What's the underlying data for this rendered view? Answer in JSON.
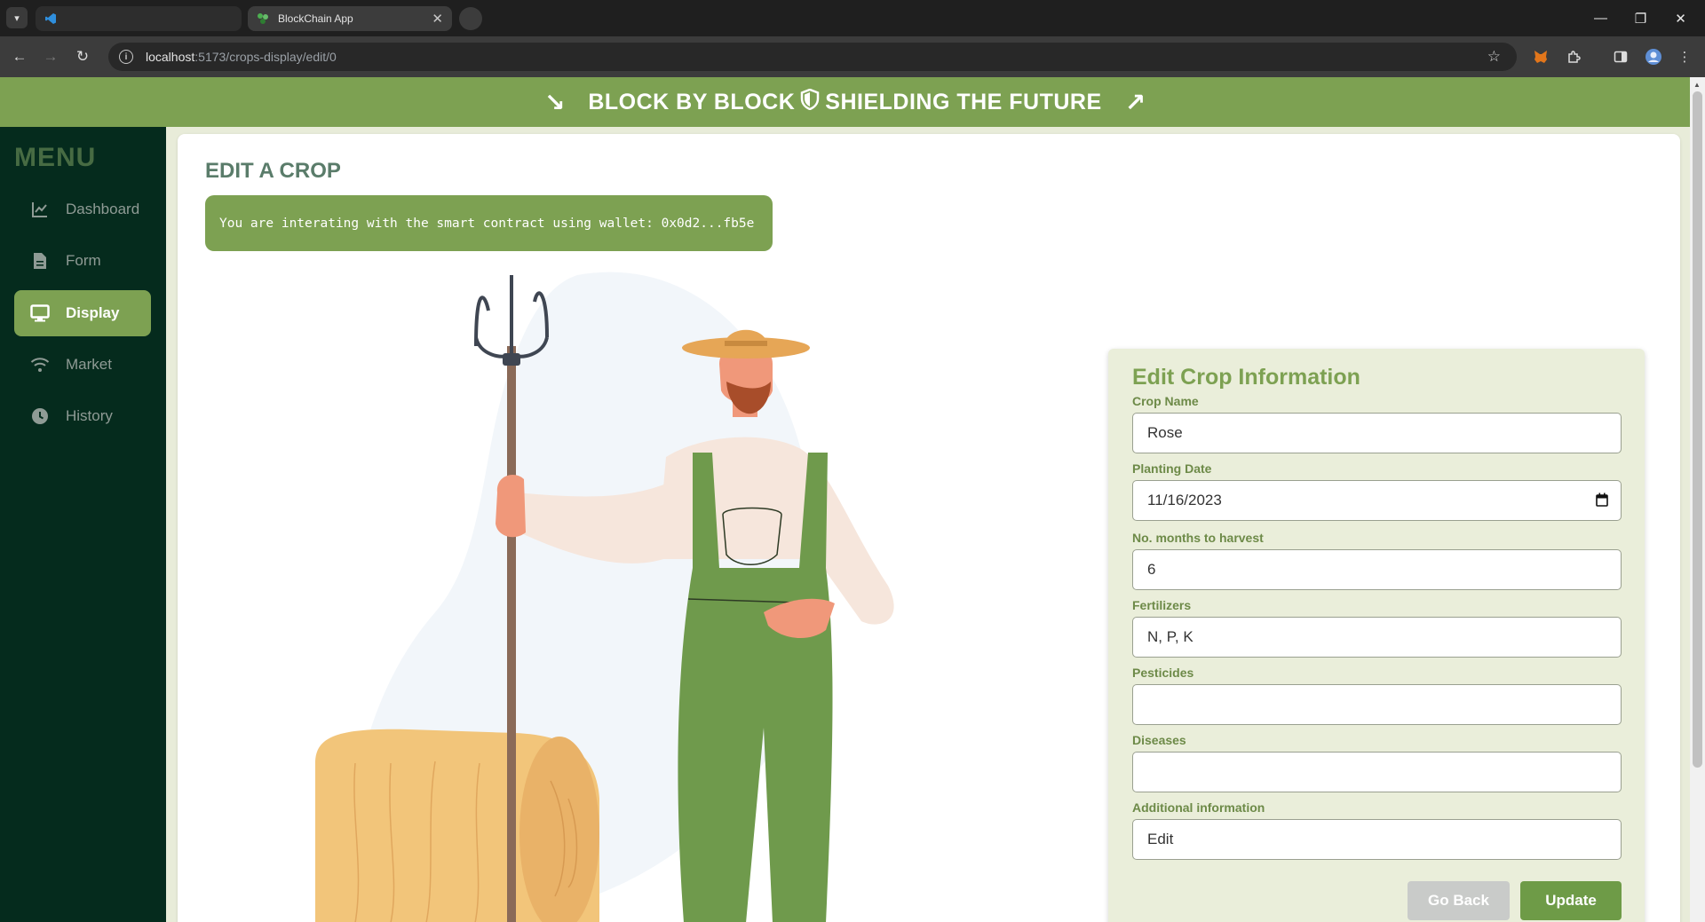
{
  "browser": {
    "tabs": [
      {
        "title": "",
        "active": false
      },
      {
        "title": "BlockChain App",
        "active": true
      }
    ],
    "url_host": "localhost",
    "url_path": ":5173/crops-display/edit/0"
  },
  "banner": {
    "text_left": "BLOCK BY BLOCK",
    "text_right": "SHIELDING THE FUTURE",
    "trend_left": "↘",
    "trend_right": "↗"
  },
  "sidebar": {
    "title": "MENU",
    "items": [
      {
        "label": "Dashboard",
        "icon": "chart-line-icon",
        "active": false
      },
      {
        "label": "Form",
        "icon": "document-icon",
        "active": false
      },
      {
        "label": "Display",
        "icon": "monitor-icon",
        "active": true
      },
      {
        "label": "Market",
        "icon": "wifi-icon",
        "active": false
      },
      {
        "label": "History",
        "icon": "clock-icon",
        "active": false
      }
    ]
  },
  "main": {
    "title": "EDIT A CROP",
    "wallet_message": "You are interating with the smart contract using wallet: 0x0d2...fb5e"
  },
  "form": {
    "title": "Edit Crop Information",
    "fields": [
      {
        "label": "Crop Name",
        "value": "Rose"
      },
      {
        "label": "Planting Date",
        "value": "11/16/2023"
      },
      {
        "label": "No. months to harvest",
        "value": "6"
      },
      {
        "label": "Fertilizers",
        "value": "N, P, K"
      },
      {
        "label": "Pesticides",
        "value": ""
      },
      {
        "label": "Diseases",
        "value": ""
      },
      {
        "label": "Additional information",
        "value": "Edit"
      }
    ],
    "buttons": {
      "back": "Go Back",
      "update": "Update"
    }
  },
  "colors": {
    "accent_green": "#7da152",
    "sidebar_bg": "#052b1d",
    "page_bg": "#e8ecd9"
  }
}
